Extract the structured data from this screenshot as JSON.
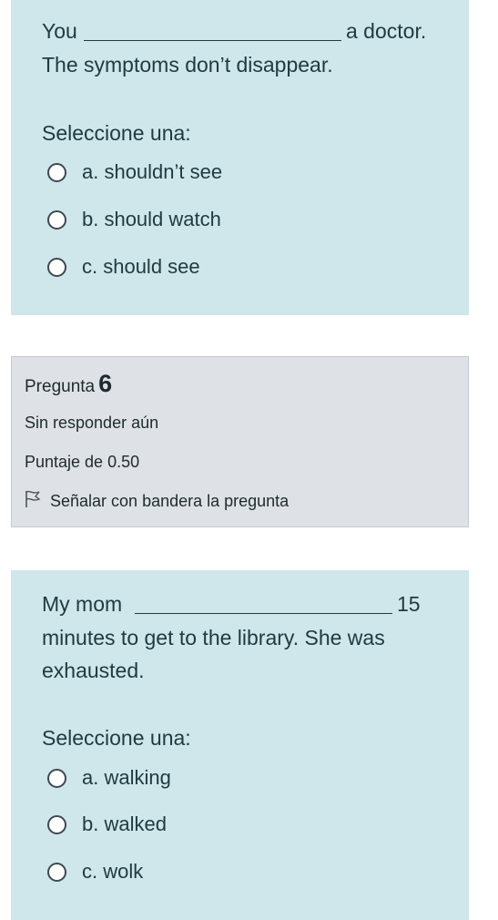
{
  "question5": {
    "text_line1_start": "You",
    "text_line1_end": "a doctor.",
    "text_line2": "The symptoms don’t disappear.",
    "prompt": "Seleccione una:",
    "options": [
      {
        "label": "a. shouldn’t see",
        "selected": false
      },
      {
        "label": "b. should watch",
        "selected": false
      },
      {
        "label": "c. should see",
        "selected": false
      }
    ]
  },
  "question6_info": {
    "label": "Pregunta",
    "number": "6",
    "status": "Sin responder aún",
    "score": "Puntaje de 0.50",
    "flag_label": "Señalar con bandera la pregunta",
    "flag_icon": "flag-outline-icon"
  },
  "question6": {
    "text_line1_start": "My mom",
    "text_line1_end": "15",
    "text_line2": "minutes to get to the library. She was",
    "text_line3": "exhausted.",
    "prompt": "Seleccione una:",
    "options": [
      {
        "label": "a. walking",
        "selected": false
      },
      {
        "label": "b. walked",
        "selected": false
      },
      {
        "label": "c. wolk",
        "selected": false
      }
    ]
  },
  "colors": {
    "question_bg": "#cfe6ea",
    "info_bg": "#dee2e6",
    "text": "#1f3a40"
  }
}
